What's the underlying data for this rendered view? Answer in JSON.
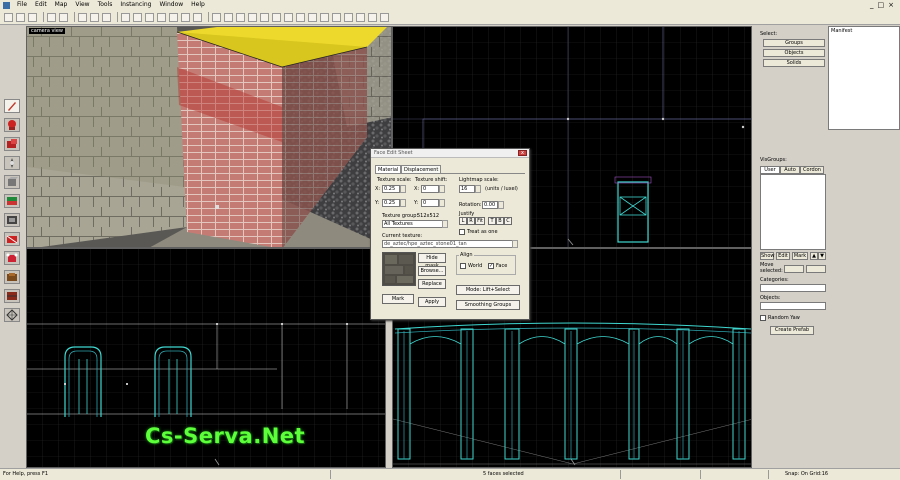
{
  "menu": [
    "File",
    "Edit",
    "Map",
    "View",
    "Tools",
    "Instancing",
    "Window",
    "Help"
  ],
  "window_controls": [
    "_",
    "□",
    "×"
  ],
  "viewport_3d_label": "camera view",
  "face_dialog": {
    "title": "Face Edit Sheet",
    "close": "x",
    "tabs": [
      "Material",
      "Displacement"
    ],
    "texture_scale_label": "Texture scale:",
    "texture_shift_label": "Texture shift:",
    "lightmap_scale_label": "Lightmap scale:",
    "lightmap_units": "(units / luxel)",
    "x_label": "X:",
    "y_label": "Y:",
    "scale_x": "0.25",
    "scale_y": "0.25",
    "shift_x": "0",
    "shift_y": "0",
    "lightmap_value": "16",
    "rotation_label": "Rotation:",
    "rotation_value": "0.00",
    "justify_label": "Justify",
    "justify_buttons": [
      "L",
      "R",
      "Fit",
      "T",
      "B",
      "C"
    ],
    "treat_as_one": "Treat as one",
    "texture_group_label": "Texture group:",
    "texture_size": "512x512",
    "texture_group_value": "All Textures",
    "current_texture_label": "Current texture:",
    "current_texture_value": "de_aztec/hpe_aztec_stone01_tan",
    "align_label": "Align",
    "align_world": "World",
    "align_face": "Face",
    "hide_mask": "Hide mask",
    "browse": "Browse...",
    "replace": "Replace",
    "mark": "Mark",
    "apply": "Apply",
    "mode": "Mode: Lift+Select",
    "smoothing_groups": "Smoothing Groups"
  },
  "right_panel": {
    "select_label": "Select:",
    "select_buttons": [
      "Groups",
      "Objects",
      "Solids"
    ],
    "manifest_label": "Manifest",
    "visgroups_label": "VisGroups:",
    "visgroup_tabs": [
      "User",
      "Auto",
      "Cordon"
    ],
    "visgroup_buttons": [
      "Show",
      "Edit",
      "Mark"
    ],
    "move_selected": "Move selected:",
    "categories_label": "Categories:",
    "objects_label": "Objects:",
    "random_yaw": "Random Yaw",
    "create_prefab": "Create Prefab"
  },
  "status": {
    "help": "For Help, press F1",
    "selection": "5 faces selected",
    "snap": "Snap: On Grid:16"
  },
  "watermark": "Cs-Serva.Net",
  "colors": {
    "grid_line": "#2a2a2a",
    "grid_major": "#3d3d3d",
    "wire_cyan": "#3fd7d0",
    "wire_white": "#e6e6e6",
    "watermark_green": "#5cff3a"
  }
}
